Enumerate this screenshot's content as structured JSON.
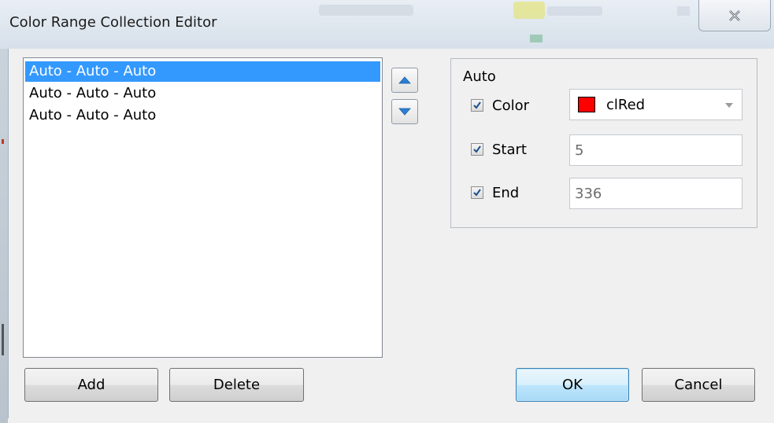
{
  "window": {
    "title": "Color Range Collection Editor",
    "close_glyph": "✕"
  },
  "list": {
    "items": [
      {
        "label": "Auto - Auto - Auto",
        "selected": true
      },
      {
        "label": "Auto - Auto - Auto",
        "selected": false
      },
      {
        "label": "Auto - Auto - Auto",
        "selected": false
      }
    ]
  },
  "move_buttons": {
    "up_icon": "arrow-up-icon",
    "down_icon": "arrow-down-icon"
  },
  "properties": {
    "group_title": "Auto",
    "color": {
      "label": "Color",
      "checked": true,
      "value": "clRed",
      "swatch": "#ff0000"
    },
    "start": {
      "label": "Start",
      "checked": true,
      "value": "5"
    },
    "end": {
      "label": "End",
      "checked": true,
      "value": "336"
    }
  },
  "buttons": {
    "add": "Add",
    "delete": "Delete",
    "ok": "OK",
    "cancel": "Cancel"
  },
  "colors": {
    "selection": "#3399ff",
    "default_button_border": "#3c7fb1",
    "arrow_icon": "#2b7fd3"
  }
}
